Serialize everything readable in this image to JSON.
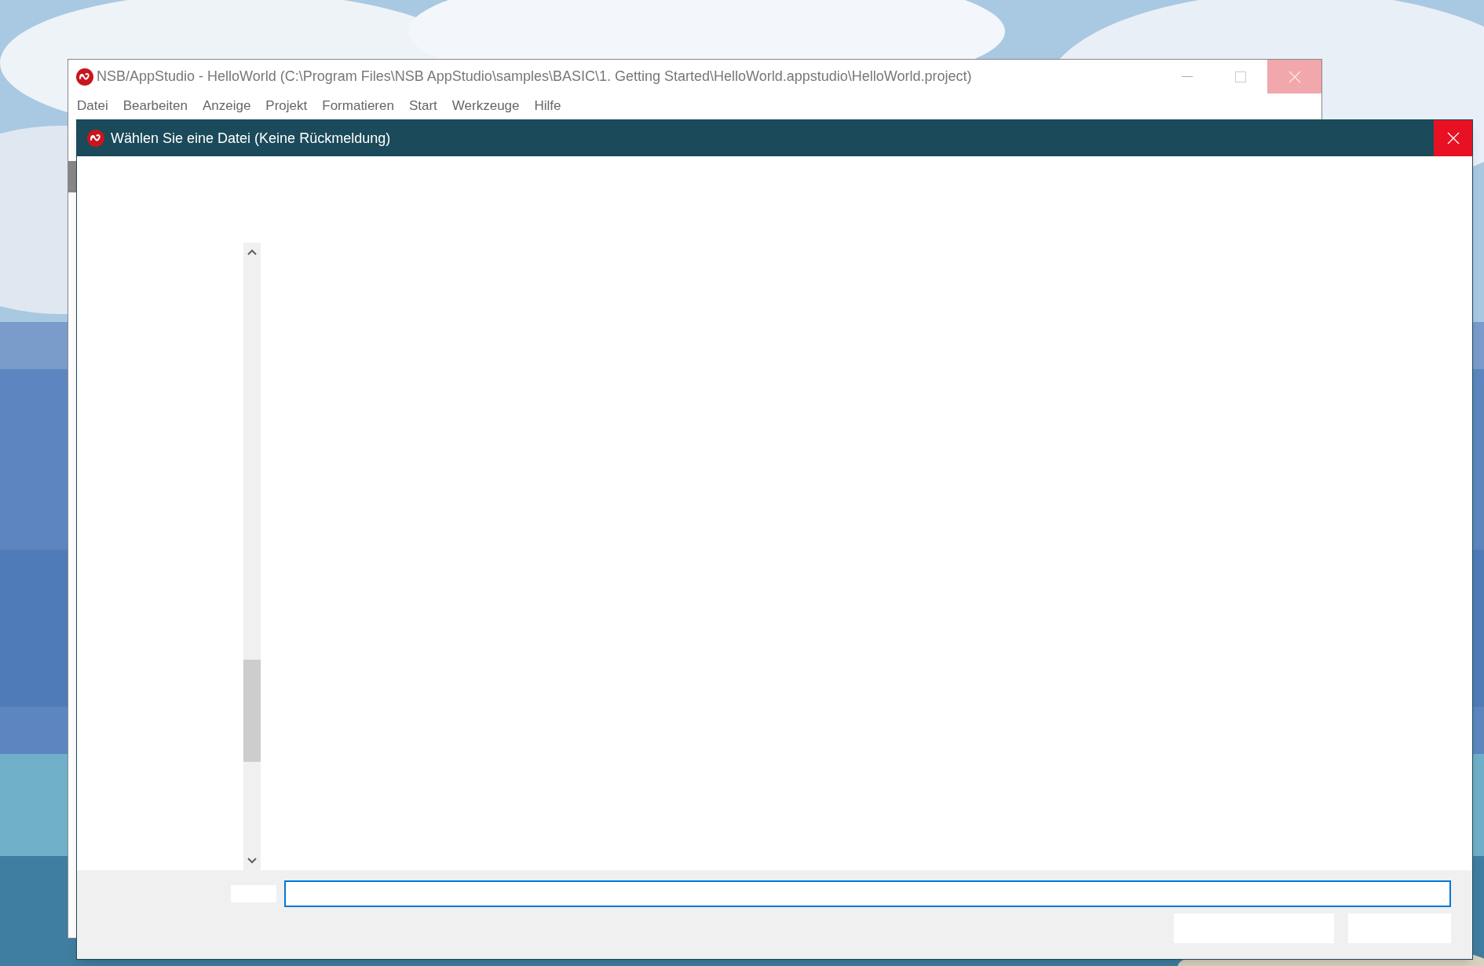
{
  "main_window": {
    "title": "NSB/AppStudio - HelloWorld (C:\\Program Files\\NSB AppStudio\\samples\\BASIC\\1. Getting Started\\HelloWorld.appstudio\\HelloWorld.project)",
    "menu": [
      "Datei",
      "Bearbeiten",
      "Anzeige",
      "Projekt",
      "Formatieren",
      "Start",
      "Werkzeuge",
      "Hilfe"
    ]
  },
  "dialog": {
    "title": "Wählen Sie eine Datei (Keine Rückmeldung)"
  }
}
